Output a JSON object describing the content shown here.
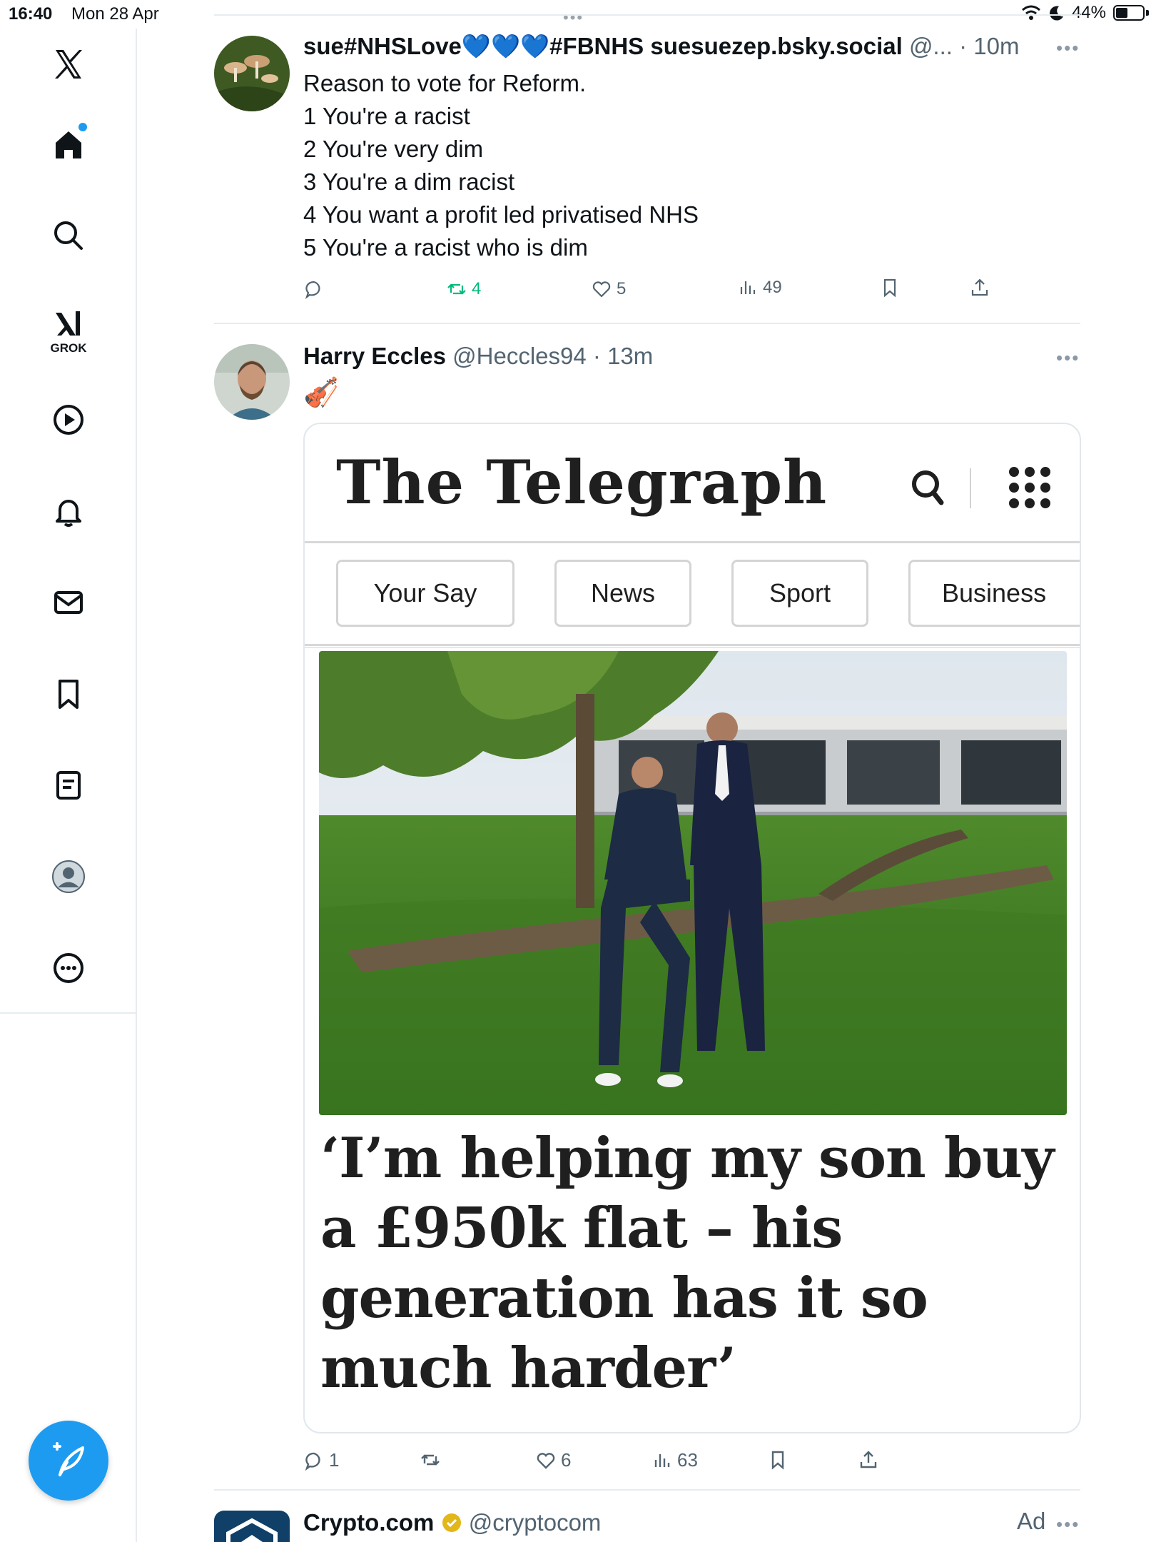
{
  "status_bar": {
    "time": "16:40",
    "date": "Mon 28 Apr",
    "battery": "44%"
  },
  "sidebar": {
    "grok_label": "GROK",
    "items": [
      "x-logo",
      "home",
      "search",
      "grok",
      "video",
      "notifications",
      "messages",
      "bookmarks",
      "lists",
      "profile",
      "more"
    ],
    "accent_color": "#1d9bf0"
  },
  "posts": [
    {
      "author": "sue#NHSLove💙💙💙#FBNHS suesuezep.bsky.social",
      "handle": "@...",
      "time": "· 10m",
      "lines": [
        "Reason to vote for Reform.",
        "1 You're a racist",
        "2 You're very dim",
        "3 You're a dim racist",
        "4 You want a profit led privatised NHS",
        "5 You're a racist who is dim"
      ],
      "actions": {
        "reposts": "4",
        "likes": "5",
        "views": "49"
      }
    },
    {
      "author": "Harry Eccles",
      "handle": "@Heccles94",
      "time": "· 13m",
      "text": "🎻",
      "media": {
        "brand": "The Telegraph",
        "tabs": [
          "Your Say",
          "News",
          "Sport",
          "Business"
        ],
        "headline": "‘I’m helping my son buy a £950k flat – his generation has it so much harder’"
      },
      "actions": {
        "replies": "1",
        "likes": "6",
        "views": "63"
      }
    },
    {
      "author": "Crypto.com",
      "handle": "@cryptocom",
      "ad_label": "Ad"
    }
  ]
}
